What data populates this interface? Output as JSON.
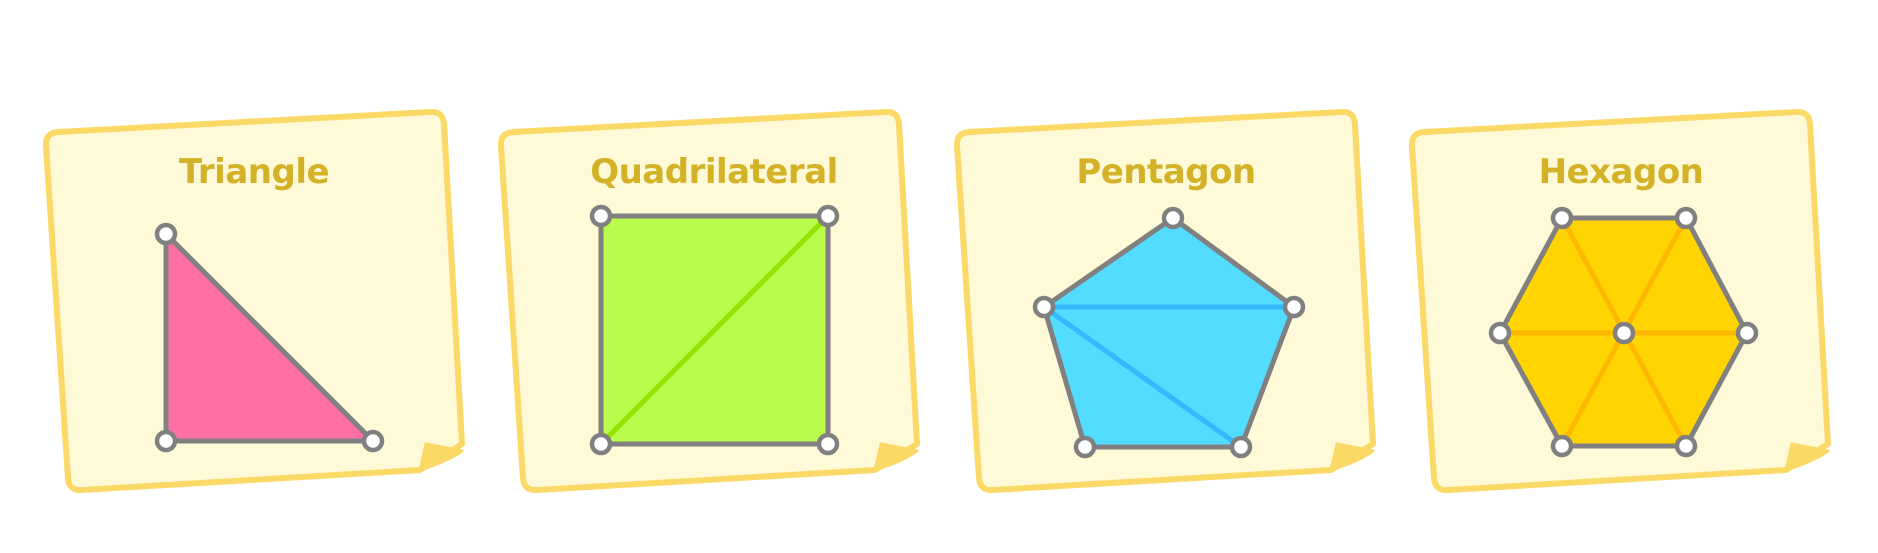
{
  "colors": {
    "background": "#ffffff",
    "card_fill": "#fef9d6",
    "card_border": "#fbd966",
    "card_fold": "#fbd966",
    "title": "#d4b227",
    "outline": "#808080",
    "vertex_fill": "#ffffff"
  },
  "cards": [
    {
      "title": "Triangle",
      "shape": "triangle",
      "fill": "#ff6fa3",
      "diagonal_color": "#ff6fa3",
      "vertex_count": 3
    },
    {
      "title": "Quadrilateral",
      "shape": "quadrilateral",
      "fill": "#b9fc4b",
      "diagonal_color": "#93e300",
      "vertex_count": 4
    },
    {
      "title": "Pentagon",
      "shape": "pentagon",
      "fill": "#52dcff",
      "diagonal_color": "#32baff",
      "vertex_count": 5
    },
    {
      "title": "Hexagon",
      "shape": "hexagon",
      "fill": "#ffd400",
      "diagonal_color": "#ffb700",
      "vertex_count": 6
    }
  ]
}
